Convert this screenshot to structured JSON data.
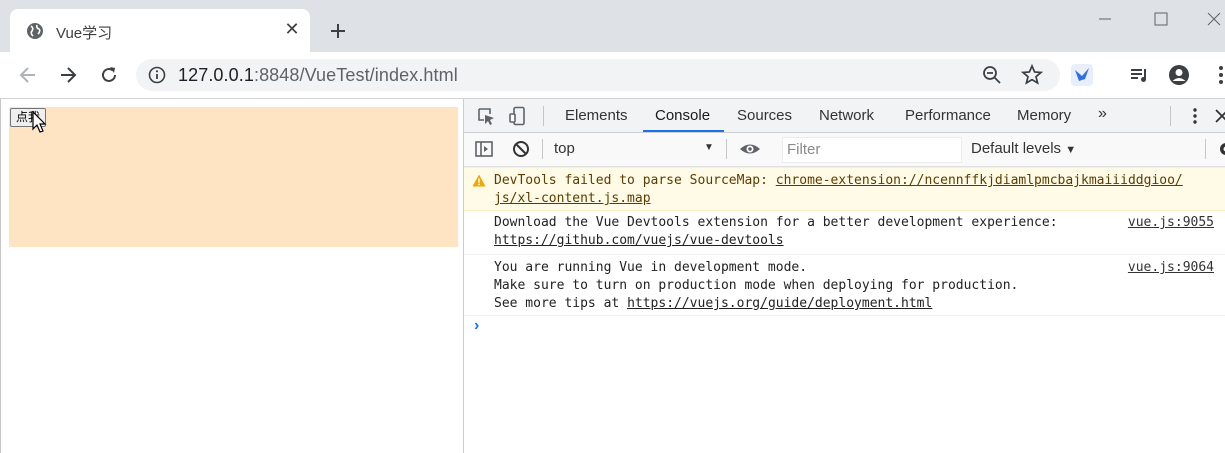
{
  "browser": {
    "tab_title": "Vue学习",
    "url_host": "127.0.0.1",
    "url_path": ":8848/VueTest/index.html"
  },
  "page": {
    "button_label": "点我",
    "box_color": "#ffe4c4"
  },
  "devtools": {
    "tabs": [
      "Elements",
      "Console",
      "Sources",
      "Network",
      "Performance",
      "Memory"
    ],
    "active_tab": "Console",
    "context": "top",
    "filter_placeholder": "Filter",
    "levels_label": "Default levels",
    "messages": [
      {
        "type": "warning",
        "line1": "DevTools failed to parse SourceMap: ",
        "link1": "chrome-extension://ncennffkjdiamlpmcbajkmaiiiddgioo/",
        "link2": "js/xl-content.js.map"
      },
      {
        "type": "log",
        "line1": "Download the Vue Devtools extension for a better development experience:",
        "link": "https://github.com/vuejs/vue-devtools",
        "source": "vue.js:9055"
      },
      {
        "type": "log",
        "line1": "You are running Vue in development mode.",
        "line2": "Make sure to turn on production mode when deploying for production.",
        "line3_prefix": "See more tips at ",
        "link": "https://vuejs.org/guide/deployment.html",
        "source": "vue.js:9064"
      }
    ],
    "prompt_symbol": "›"
  },
  "colors": {
    "accent": "#1a73e8",
    "warning_bg": "#fffbe6"
  }
}
